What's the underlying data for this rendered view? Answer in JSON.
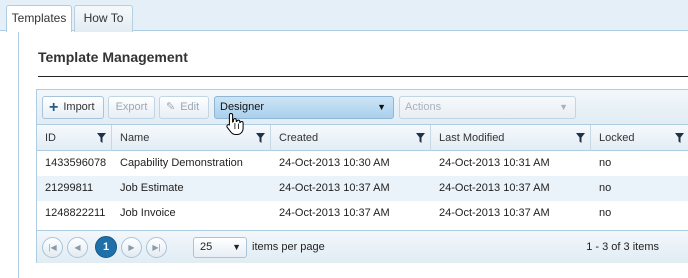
{
  "tabs": [
    {
      "label": "Templates",
      "active": true
    },
    {
      "label": "How To",
      "active": false
    }
  ],
  "page_title": "Template Management",
  "toolbar": {
    "import_label": "Import",
    "export_label": "Export",
    "edit_label": "Edit",
    "designer_value": "Designer",
    "actions_placeholder": "Actions"
  },
  "columns": {
    "id": "ID",
    "name": "Name",
    "created": "Created",
    "modified": "Last Modified",
    "locked": "Locked"
  },
  "rows": [
    {
      "id": "1433596078",
      "name": "Capability Demonstration",
      "created": "24-Oct-2013 10:30 AM",
      "modified": "24-Oct-2013 10:31 AM",
      "locked": "no"
    },
    {
      "id": "21299811",
      "name": "Job Estimate",
      "created": "24-Oct-2013 10:37 AM",
      "modified": "24-Oct-2013 10:37 AM",
      "locked": "no"
    },
    {
      "id": "1248822211",
      "name": "Job Invoice",
      "created": "24-Oct-2013 10:37 AM",
      "modified": "24-Oct-2013 10:37 AM",
      "locked": "no"
    }
  ],
  "pager": {
    "current_page": "1",
    "page_size": "25",
    "page_size_label": "items per page",
    "info": "1 - 3 of 3 items"
  },
  "colors": {
    "accent": "#1f70a8",
    "selected_dropdown": "#a9d0ee",
    "alt_row": "#eaf3fa",
    "border": "#aecde2"
  }
}
